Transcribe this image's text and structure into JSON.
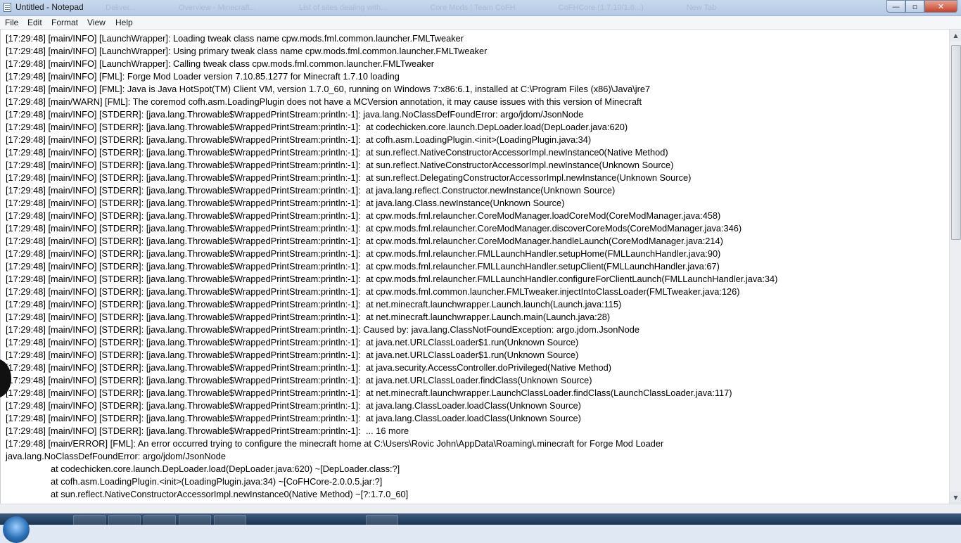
{
  "window": {
    "title": "Untitled - Notepad",
    "ghost_tabs": [
      "Deliver...",
      "Overview - Minecraft...",
      "List of sites dealing with...",
      "Core Mods | Team CoFH",
      "CoFHCore (1.7.10/1.6...)",
      "New Tab"
    ],
    "controls": {
      "minimize": "—",
      "maximize": "▫",
      "close": "✕"
    }
  },
  "menu": [
    "File",
    "Edit",
    "Format",
    "View",
    "Help"
  ],
  "editor": {
    "lines": [
      "[17:29:48] [main/INFO] [LaunchWrapper]: Loading tweak class name cpw.mods.fml.common.launcher.FMLTweaker",
      "[17:29:48] [main/INFO] [LaunchWrapper]: Using primary tweak class name cpw.mods.fml.common.launcher.FMLTweaker",
      "[17:29:48] [main/INFO] [LaunchWrapper]: Calling tweak class cpw.mods.fml.common.launcher.FMLTweaker",
      "[17:29:48] [main/INFO] [FML]: Forge Mod Loader version 7.10.85.1277 for Minecraft 1.7.10 loading",
      "[17:29:48] [main/INFO] [FML]: Java is Java HotSpot(TM) Client VM, version 1.7.0_60, running on Windows 7:x86:6.1, installed at C:\\Program Files (x86)\\Java\\jre7",
      "[17:29:48] [main/WARN] [FML]: The coremod cofh.asm.LoadingPlugin does not have a MCVersion annotation, it may cause issues with this version of Minecraft",
      "[17:29:48] [main/INFO] [STDERR]: [java.lang.Throwable$WrappedPrintStream:println:-1]: java.lang.NoClassDefFoundError: argo/jdom/JsonNode",
      "[17:29:48] [main/INFO] [STDERR]: [java.lang.Throwable$WrappedPrintStream:println:-1]:\tat codechicken.core.launch.DepLoader.load(DepLoader.java:620)",
      "[17:29:48] [main/INFO] [STDERR]: [java.lang.Throwable$WrappedPrintStream:println:-1]:\tat cofh.asm.LoadingPlugin.<init>(LoadingPlugin.java:34)",
      "[17:29:48] [main/INFO] [STDERR]: [java.lang.Throwable$WrappedPrintStream:println:-1]:\tat sun.reflect.NativeConstructorAccessorImpl.newInstance0(Native Method)",
      "[17:29:48] [main/INFO] [STDERR]: [java.lang.Throwable$WrappedPrintStream:println:-1]:\tat sun.reflect.NativeConstructorAccessorImpl.newInstance(Unknown Source)",
      "[17:29:48] [main/INFO] [STDERR]: [java.lang.Throwable$WrappedPrintStream:println:-1]:\tat sun.reflect.DelegatingConstructorAccessorImpl.newInstance(Unknown Source)",
      "[17:29:48] [main/INFO] [STDERR]: [java.lang.Throwable$WrappedPrintStream:println:-1]:\tat java.lang.reflect.Constructor.newInstance(Unknown Source)",
      "[17:29:48] [main/INFO] [STDERR]: [java.lang.Throwable$WrappedPrintStream:println:-1]:\tat java.lang.Class.newInstance(Unknown Source)",
      "[17:29:48] [main/INFO] [STDERR]: [java.lang.Throwable$WrappedPrintStream:println:-1]:\tat cpw.mods.fml.relauncher.CoreModManager.loadCoreMod(CoreModManager.java:458)",
      "[17:29:48] [main/INFO] [STDERR]: [java.lang.Throwable$WrappedPrintStream:println:-1]:\tat cpw.mods.fml.relauncher.CoreModManager.discoverCoreMods(CoreModManager.java:346)",
      "[17:29:48] [main/INFO] [STDERR]: [java.lang.Throwable$WrappedPrintStream:println:-1]:\tat cpw.mods.fml.relauncher.CoreModManager.handleLaunch(CoreModManager.java:214)",
      "[17:29:48] [main/INFO] [STDERR]: [java.lang.Throwable$WrappedPrintStream:println:-1]:\tat cpw.mods.fml.relauncher.FMLLaunchHandler.setupHome(FMLLaunchHandler.java:90)",
      "[17:29:48] [main/INFO] [STDERR]: [java.lang.Throwable$WrappedPrintStream:println:-1]:\tat cpw.mods.fml.relauncher.FMLLaunchHandler.setupClient(FMLLaunchHandler.java:67)",
      "[17:29:48] [main/INFO] [STDERR]: [java.lang.Throwable$WrappedPrintStream:println:-1]:\tat cpw.mods.fml.relauncher.FMLLaunchHandler.configureForClientLaunch(FMLLaunchHandler.java:34)",
      "[17:29:48] [main/INFO] [STDERR]: [java.lang.Throwable$WrappedPrintStream:println:-1]:\tat cpw.mods.fml.common.launcher.FMLTweaker.injectIntoClassLoader(FMLTweaker.java:126)",
      "[17:29:48] [main/INFO] [STDERR]: [java.lang.Throwable$WrappedPrintStream:println:-1]:\tat net.minecraft.launchwrapper.Launch.launch(Launch.java:115)",
      "[17:29:48] [main/INFO] [STDERR]: [java.lang.Throwable$WrappedPrintStream:println:-1]:\tat net.minecraft.launchwrapper.Launch.main(Launch.java:28)",
      "[17:29:48] [main/INFO] [STDERR]: [java.lang.Throwable$WrappedPrintStream:println:-1]: Caused by: java.lang.ClassNotFoundException: argo.jdom.JsonNode",
      "[17:29:48] [main/INFO] [STDERR]: [java.lang.Throwable$WrappedPrintStream:println:-1]:\tat java.net.URLClassLoader$1.run(Unknown Source)",
      "[17:29:48] [main/INFO] [STDERR]: [java.lang.Throwable$WrappedPrintStream:println:-1]:\tat java.net.URLClassLoader$1.run(Unknown Source)",
      "[17:29:48] [main/INFO] [STDERR]: [java.lang.Throwable$WrappedPrintStream:println:-1]:\tat java.security.AccessController.doPrivileged(Native Method)",
      "[17:29:48] [main/INFO] [STDERR]: [java.lang.Throwable$WrappedPrintStream:println:-1]:\tat java.net.URLClassLoader.findClass(Unknown Source)",
      "[17:29:48] [main/INFO] [STDERR]: [java.lang.Throwable$WrappedPrintStream:println:-1]:\tat net.minecraft.launchwrapper.LaunchClassLoader.findClass(LaunchClassLoader.java:117)",
      "[17:29:48] [main/INFO] [STDERR]: [java.lang.Throwable$WrappedPrintStream:println:-1]:\tat java.lang.ClassLoader.loadClass(Unknown Source)",
      "[17:29:48] [main/INFO] [STDERR]: [java.lang.Throwable$WrappedPrintStream:println:-1]:\tat java.lang.ClassLoader.loadClass(Unknown Source)",
      "[17:29:48] [main/INFO] [STDERR]: [java.lang.Throwable$WrappedPrintStream:println:-1]:\t... 16 more",
      "[17:29:48] [main/ERROR] [FML]: An error occurred trying to configure the minecraft home at C:\\Users\\Rovic John\\AppData\\Roaming\\.minecraft for Forge Mod Loader",
      "java.lang.NoClassDefFoundError: argo/jdom/JsonNode",
      "\tat codechicken.core.launch.DepLoader.load(DepLoader.java:620) ~[DepLoader.class:?]",
      "\tat cofh.asm.LoadingPlugin.<init>(LoadingPlugin.java:34) ~[CoFHCore-2.0.0.5.jar:?]",
      "\tat sun.reflect.NativeConstructorAccessorImpl.newInstance0(Native Method) ~[?:1.7.0_60]"
    ]
  }
}
